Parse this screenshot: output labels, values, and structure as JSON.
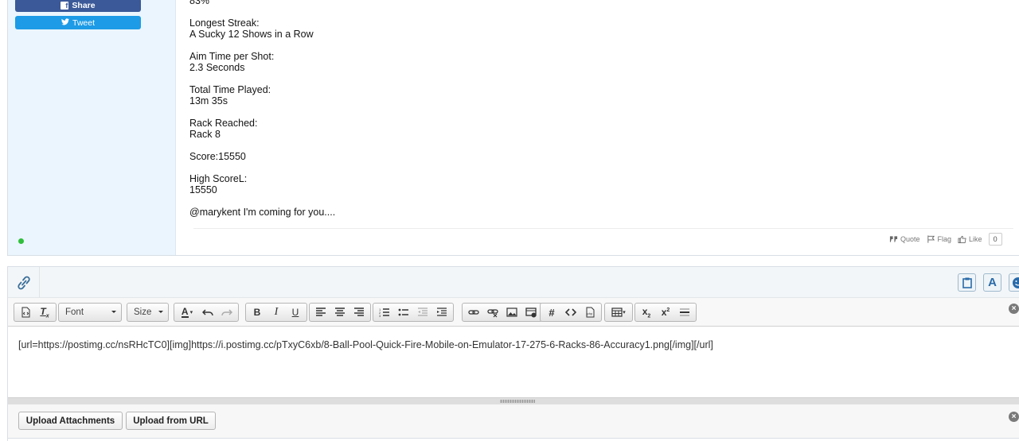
{
  "sidebar": {
    "share_label": "Share",
    "tweet_label": "Tweet"
  },
  "message": {
    "lines": [
      [
        "83%"
      ],
      [
        "Longest Streak:",
        "A Sucky 12 Shows in a Row"
      ],
      [
        "Aim Time per Shot:",
        "2.3 Seconds"
      ],
      [
        "Total Time Played:",
        "13m 35s"
      ],
      [
        "Rack Reached:",
        "Rack 8"
      ],
      [
        "Score:15550"
      ],
      [
        "High ScoreL:",
        "15550"
      ],
      [
        "@marykent I'm coming for you...."
      ]
    ]
  },
  "post_actions": {
    "quote": "Quote",
    "flag": "Flag",
    "like": "Like",
    "like_count": "0"
  },
  "editor": {
    "font_combo": "Font",
    "size_combo": "Size",
    "content": "[url=https://postimg.cc/nsRHcTC0][img]https://i.postimg.cc/pTxyC6xb/8-Ball-Pool-Quick-Fire-Mobile-on-Emulator-17-275-6-Racks-86-Accuracy1.png[/img][/url]",
    "top_letter": "A"
  },
  "upload": {
    "attachments_label": "Upload Attachments",
    "url_label": "Upload from URL"
  },
  "colors": {
    "sidebar_bg": "#eaf5fd",
    "facebook": "#3b5998",
    "twitter": "#1d9be6",
    "online": "#2fbf3b"
  }
}
